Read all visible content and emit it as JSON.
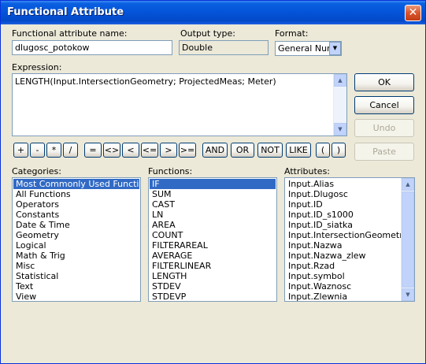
{
  "window": {
    "title": "Functional Attribute"
  },
  "labels": {
    "name": "Functional attribute name:",
    "output_type": "Output type:",
    "format": "Format:",
    "expression": "Expression:",
    "categories": "Categories:",
    "functions": "Functions:",
    "attributes": "Attributes:"
  },
  "fields": {
    "name_value": "dlugosc_potokow",
    "output_type_value": "Double",
    "format_value": "General Number"
  },
  "expression": {
    "text": "LENGTH(Input.IntersectionGeometry; ProjectedMeas; Meter)"
  },
  "buttons": {
    "ok": "OK",
    "cancel": "Cancel",
    "undo": "Undo",
    "paste": "Paste"
  },
  "operators": [
    "+",
    "-",
    "*",
    "/",
    "=",
    "<>",
    "<",
    "<=",
    ">",
    ">=",
    "AND",
    "OR",
    "NOT",
    "LIKE",
    "(",
    ")"
  ],
  "categories": [
    "Most Commonly Used Functions",
    "All Functions",
    "Operators",
    "Constants",
    "Date & Time",
    "Geometry",
    "Logical",
    "Math & Trig",
    "Misc",
    "Statistical",
    "Text",
    "View"
  ],
  "functions": [
    "IF",
    "SUM",
    "CAST",
    "LN",
    "AREA",
    "COUNT",
    "FILTERAREAL",
    "AVERAGE",
    "FILTERLINEAR",
    "LENGTH",
    "STDEV",
    "STDEVP"
  ],
  "attributes": [
    "Input.Alias",
    "Input.Dlugosc",
    "Input.ID",
    "Input.ID_s1000",
    "Input.ID_siatka",
    "Input.IntersectionGeometry",
    "Input.Nazwa",
    "Input.Nazwa_zlew",
    "Input.Rzad",
    "Input.symbol",
    "Input.Waznosc",
    "Input.Zlewnia"
  ]
}
